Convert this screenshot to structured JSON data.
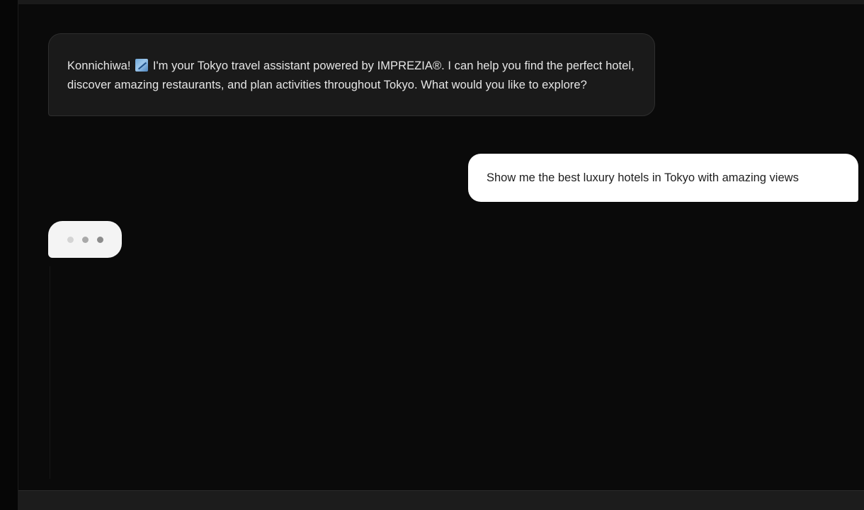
{
  "chat": {
    "messages": [
      {
        "role": "assistant",
        "text_before_icon": "Konnichiwa!",
        "icon": "japan-flag-icon",
        "text_after_icon": "I'm your Tokyo travel assistant powered by IMPREZIA®. I can help you find the perfect hotel, discover amazing restaurants, and plan activities throughout Tokyo. What would you like to explore?"
      },
      {
        "role": "user",
        "text": "Show me the best luxury hotels in Tokyo with amazing views"
      }
    ],
    "typing_indicator": {
      "visible": true,
      "dots": 3
    }
  },
  "colors": {
    "background": "#0a0a0a",
    "assistant_bubble": "#1a1a1a",
    "user_bubble": "#ffffff",
    "typing_bubble": "#f4f4f4"
  }
}
